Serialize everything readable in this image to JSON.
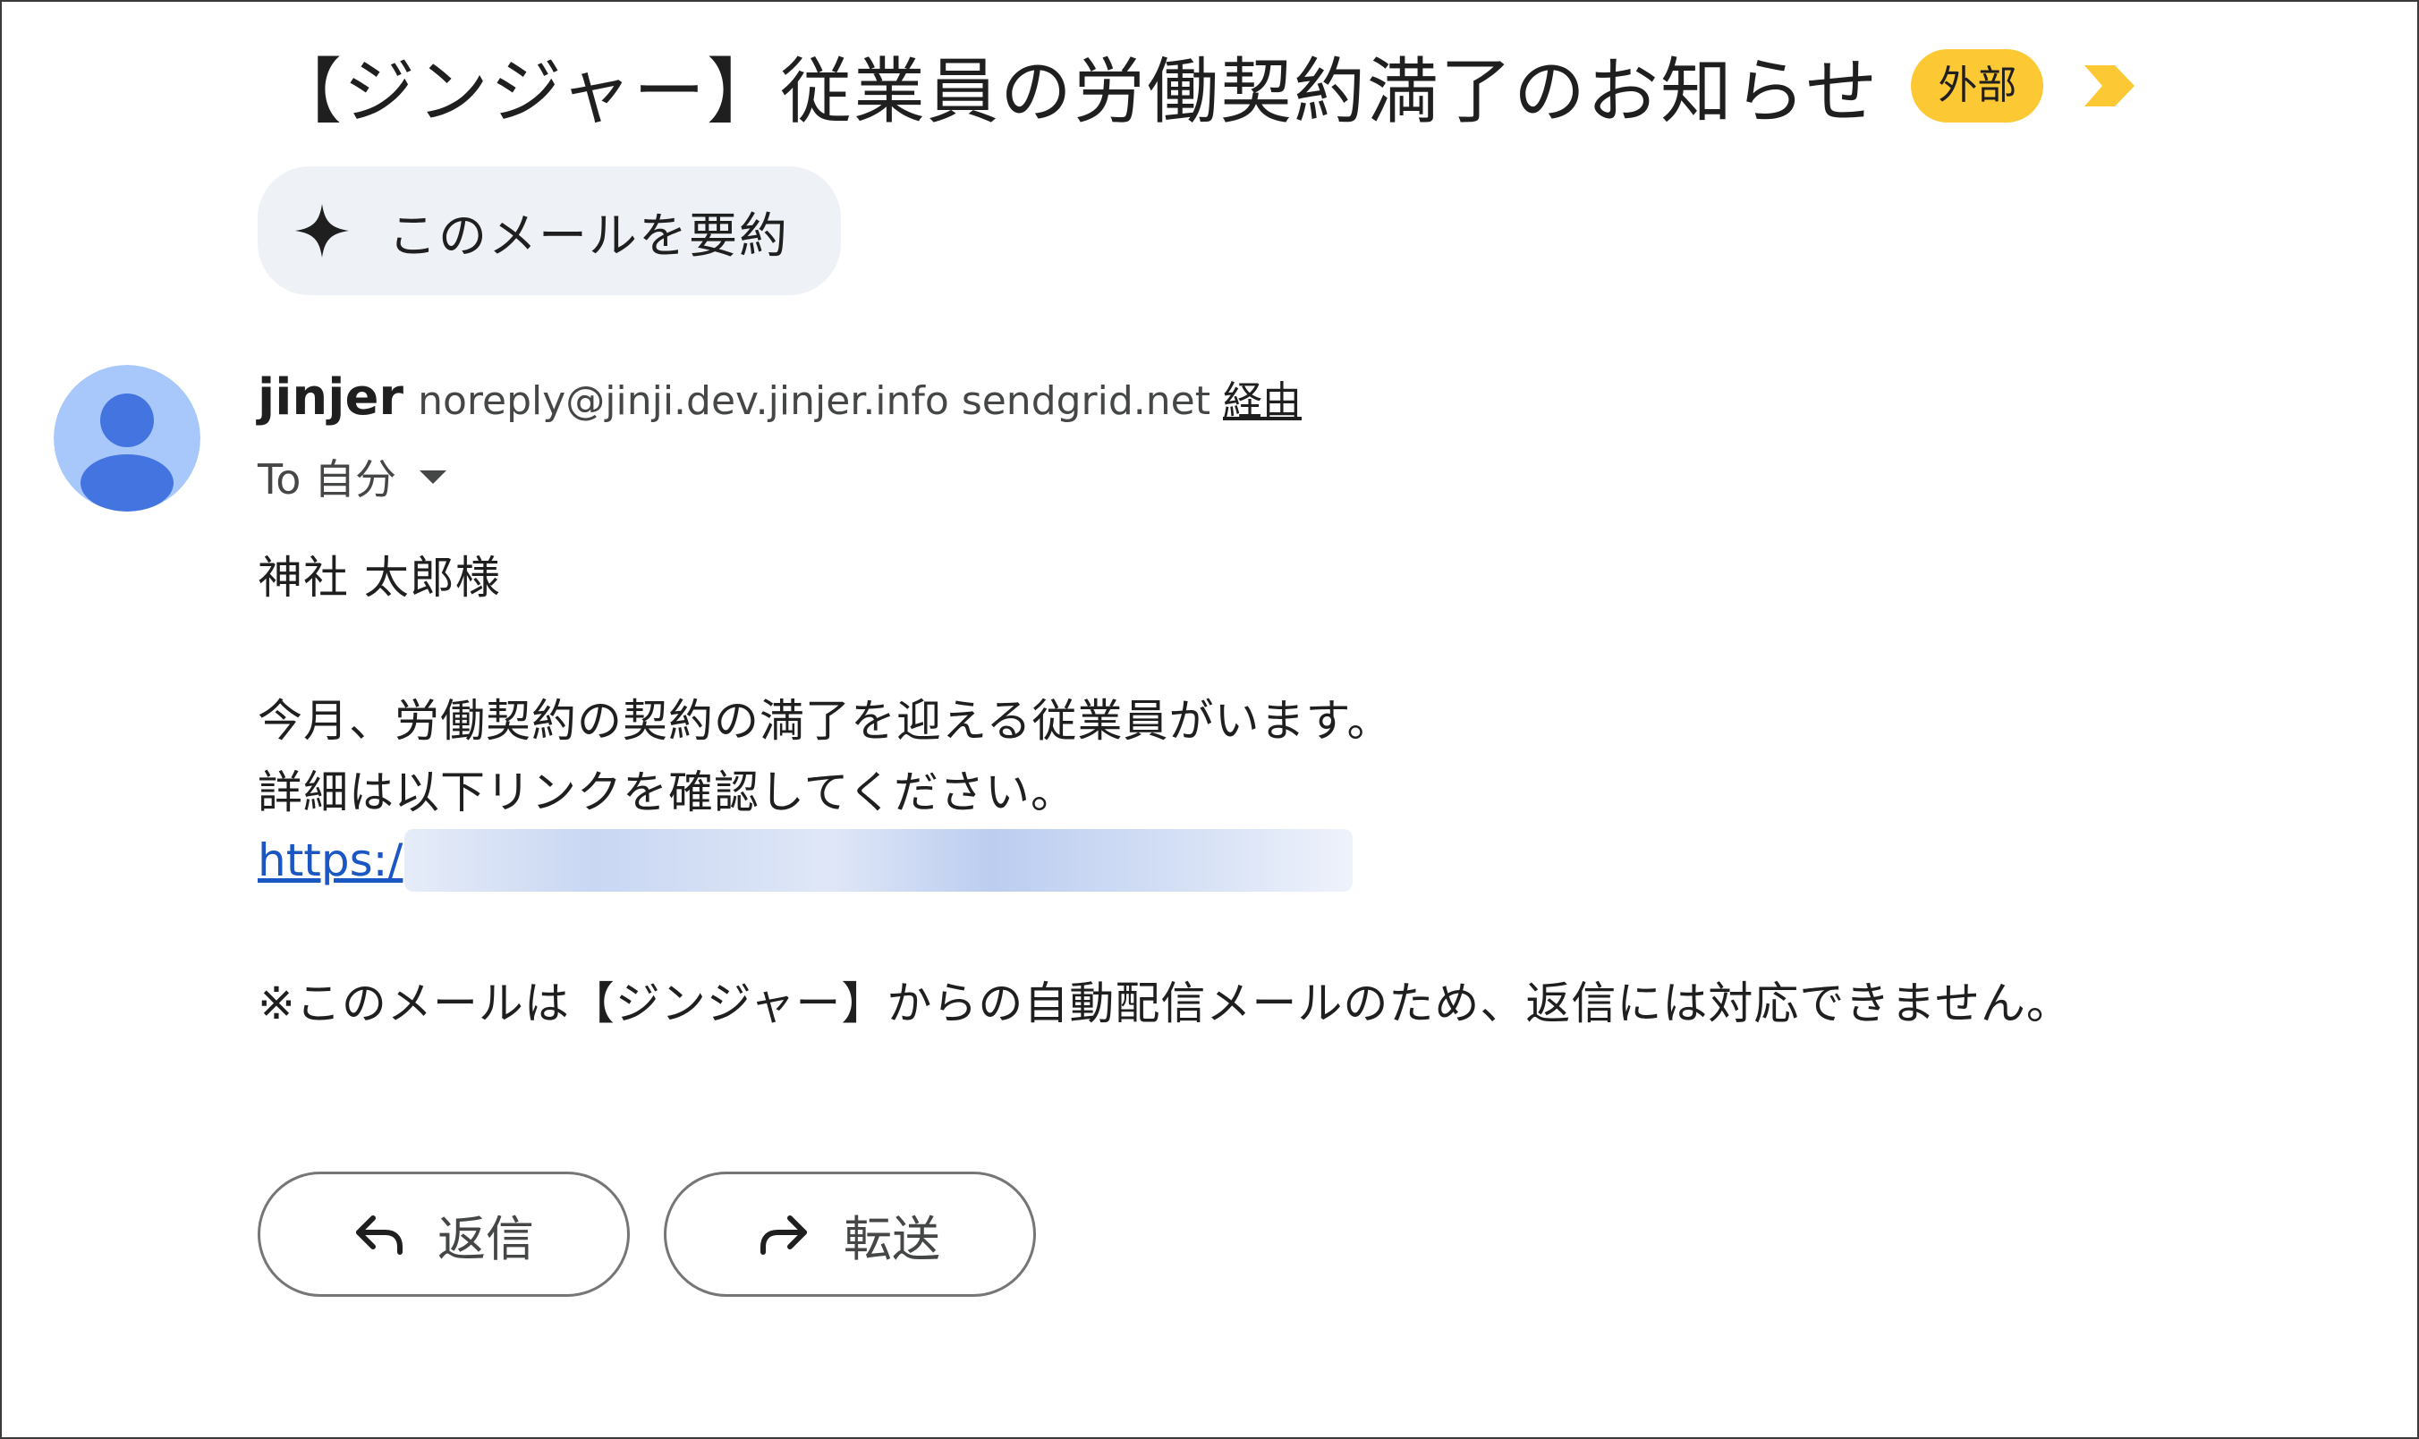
{
  "email": {
    "subject": "【ジンジャー】従業員の労働契約満了のお知らせ",
    "badge": "外部",
    "summarize_label": "このメールを要約",
    "sender": {
      "name": "jinjer",
      "email": "noreply@jinji.dev.jinjer.info sendgrid.net",
      "via": "経由"
    },
    "recipient": "To 自分",
    "body": {
      "greeting": "神社 太郎様",
      "line1": "今月、労働契約の契約の満了を迎える従業員がいます。",
      "line2": "詳細は以下リンクを確認してください。",
      "link_visible": "https:/",
      "footer_note": "※このメールは【ジンジャー】からの自動配信メールのため、返信には対応できません。"
    },
    "actions": {
      "reply": "返信",
      "forward": "転送"
    }
  },
  "colors": {
    "badge_bg": "#fcc934",
    "important_marker": "#fcc934",
    "avatar_bg": "#a8c7fa",
    "avatar_fg": "#4374e0",
    "link": "#1a56c4",
    "summarize_bg": "#eef1f6"
  },
  "icons": {
    "summarize": "sparkle-icon",
    "important": "important-marker-icon",
    "avatar": "default-person-avatar",
    "caret": "chevron-down-icon",
    "reply": "reply-arrow-icon",
    "forward": "forward-arrow-icon"
  }
}
